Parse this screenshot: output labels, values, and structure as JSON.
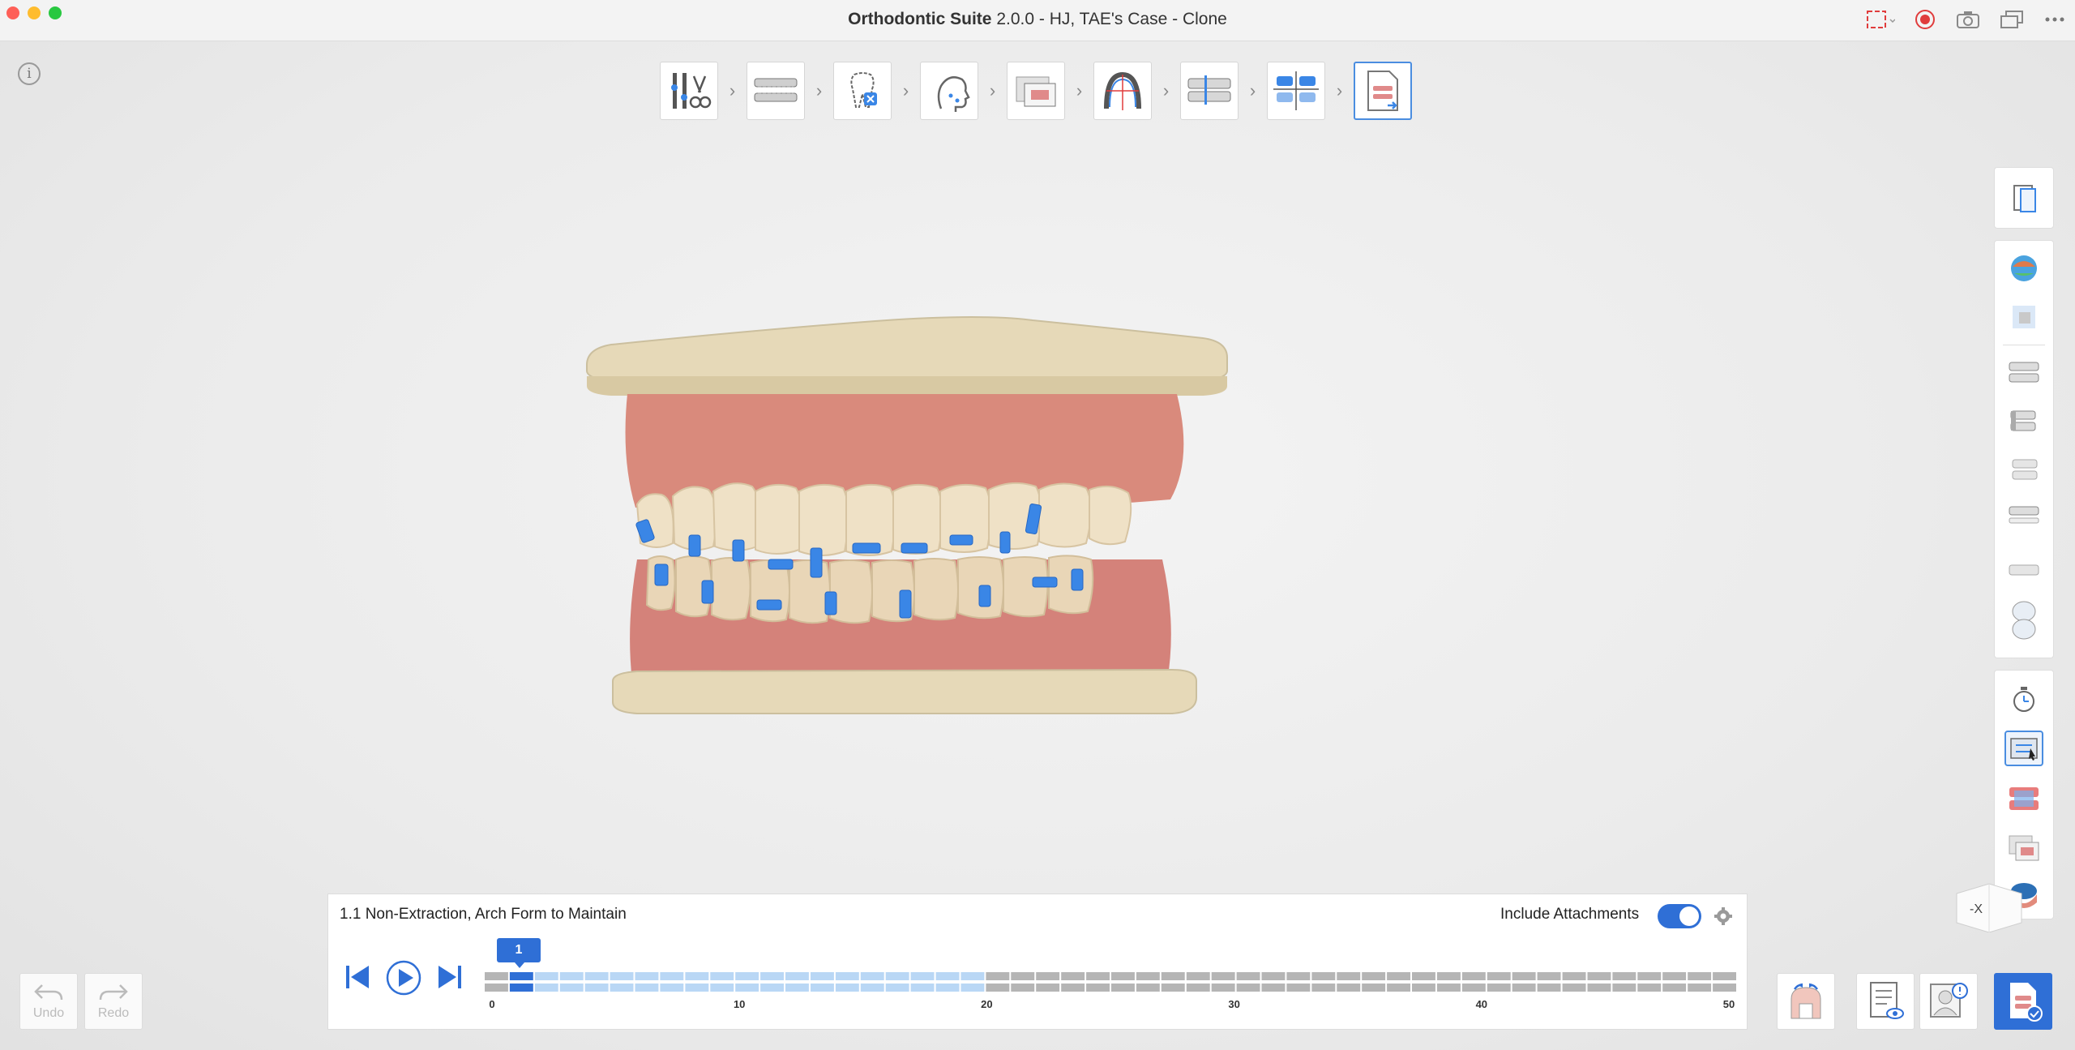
{
  "window": {
    "title_app": "Orthodontic Suite",
    "title_rest": " 2.0.0 - HJ, TAE's Case - Clone"
  },
  "colors": {
    "accent": "#2f6fd6",
    "gum": "#d9867a",
    "base": "#e3d5b5",
    "attachment": "#3a86e6"
  },
  "workflow_steps": [
    "tools-step",
    "scan-step",
    "segmentation-step",
    "face-step",
    "image-step",
    "arch-step",
    "bite-step",
    "alignment-step",
    "export-step"
  ],
  "info": {
    "label": "i"
  },
  "timeline": {
    "plan_name": "1.1 Non-Extraction, Arch Form to Maintain",
    "include_attachments_label": "Include Attachments",
    "include_attachments_on": true,
    "current_step": "1",
    "current_step_value": 1,
    "active_until": 20,
    "total_steps": 50,
    "tick_labels": [
      "0",
      "10",
      "20",
      "30",
      "40",
      "50"
    ]
  },
  "undo": {
    "label": "Undo"
  },
  "redo": {
    "label": "Redo"
  }
}
